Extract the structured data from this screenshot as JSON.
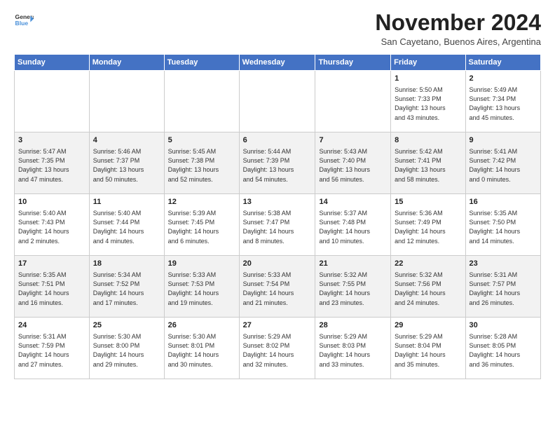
{
  "logo": {
    "line1": "General",
    "line2": "Blue"
  },
  "title": "November 2024",
  "location": "San Cayetano, Buenos Aires, Argentina",
  "days_of_week": [
    "Sunday",
    "Monday",
    "Tuesday",
    "Wednesday",
    "Thursday",
    "Friday",
    "Saturday"
  ],
  "weeks": [
    [
      {
        "day": "",
        "info": ""
      },
      {
        "day": "",
        "info": ""
      },
      {
        "day": "",
        "info": ""
      },
      {
        "day": "",
        "info": ""
      },
      {
        "day": "",
        "info": ""
      },
      {
        "day": "1",
        "info": "Sunrise: 5:50 AM\nSunset: 7:33 PM\nDaylight: 13 hours\nand 43 minutes."
      },
      {
        "day": "2",
        "info": "Sunrise: 5:49 AM\nSunset: 7:34 PM\nDaylight: 13 hours\nand 45 minutes."
      }
    ],
    [
      {
        "day": "3",
        "info": "Sunrise: 5:47 AM\nSunset: 7:35 PM\nDaylight: 13 hours\nand 47 minutes."
      },
      {
        "day": "4",
        "info": "Sunrise: 5:46 AM\nSunset: 7:37 PM\nDaylight: 13 hours\nand 50 minutes."
      },
      {
        "day": "5",
        "info": "Sunrise: 5:45 AM\nSunset: 7:38 PM\nDaylight: 13 hours\nand 52 minutes."
      },
      {
        "day": "6",
        "info": "Sunrise: 5:44 AM\nSunset: 7:39 PM\nDaylight: 13 hours\nand 54 minutes."
      },
      {
        "day": "7",
        "info": "Sunrise: 5:43 AM\nSunset: 7:40 PM\nDaylight: 13 hours\nand 56 minutes."
      },
      {
        "day": "8",
        "info": "Sunrise: 5:42 AM\nSunset: 7:41 PM\nDaylight: 13 hours\nand 58 minutes."
      },
      {
        "day": "9",
        "info": "Sunrise: 5:41 AM\nSunset: 7:42 PM\nDaylight: 14 hours\nand 0 minutes."
      }
    ],
    [
      {
        "day": "10",
        "info": "Sunrise: 5:40 AM\nSunset: 7:43 PM\nDaylight: 14 hours\nand 2 minutes."
      },
      {
        "day": "11",
        "info": "Sunrise: 5:40 AM\nSunset: 7:44 PM\nDaylight: 14 hours\nand 4 minutes."
      },
      {
        "day": "12",
        "info": "Sunrise: 5:39 AM\nSunset: 7:45 PM\nDaylight: 14 hours\nand 6 minutes."
      },
      {
        "day": "13",
        "info": "Sunrise: 5:38 AM\nSunset: 7:47 PM\nDaylight: 14 hours\nand 8 minutes."
      },
      {
        "day": "14",
        "info": "Sunrise: 5:37 AM\nSunset: 7:48 PM\nDaylight: 14 hours\nand 10 minutes."
      },
      {
        "day": "15",
        "info": "Sunrise: 5:36 AM\nSunset: 7:49 PM\nDaylight: 14 hours\nand 12 minutes."
      },
      {
        "day": "16",
        "info": "Sunrise: 5:35 AM\nSunset: 7:50 PM\nDaylight: 14 hours\nand 14 minutes."
      }
    ],
    [
      {
        "day": "17",
        "info": "Sunrise: 5:35 AM\nSunset: 7:51 PM\nDaylight: 14 hours\nand 16 minutes."
      },
      {
        "day": "18",
        "info": "Sunrise: 5:34 AM\nSunset: 7:52 PM\nDaylight: 14 hours\nand 17 minutes."
      },
      {
        "day": "19",
        "info": "Sunrise: 5:33 AM\nSunset: 7:53 PM\nDaylight: 14 hours\nand 19 minutes."
      },
      {
        "day": "20",
        "info": "Sunrise: 5:33 AM\nSunset: 7:54 PM\nDaylight: 14 hours\nand 21 minutes."
      },
      {
        "day": "21",
        "info": "Sunrise: 5:32 AM\nSunset: 7:55 PM\nDaylight: 14 hours\nand 23 minutes."
      },
      {
        "day": "22",
        "info": "Sunrise: 5:32 AM\nSunset: 7:56 PM\nDaylight: 14 hours\nand 24 minutes."
      },
      {
        "day": "23",
        "info": "Sunrise: 5:31 AM\nSunset: 7:57 PM\nDaylight: 14 hours\nand 26 minutes."
      }
    ],
    [
      {
        "day": "24",
        "info": "Sunrise: 5:31 AM\nSunset: 7:59 PM\nDaylight: 14 hours\nand 27 minutes."
      },
      {
        "day": "25",
        "info": "Sunrise: 5:30 AM\nSunset: 8:00 PM\nDaylight: 14 hours\nand 29 minutes."
      },
      {
        "day": "26",
        "info": "Sunrise: 5:30 AM\nSunset: 8:01 PM\nDaylight: 14 hours\nand 30 minutes."
      },
      {
        "day": "27",
        "info": "Sunrise: 5:29 AM\nSunset: 8:02 PM\nDaylight: 14 hours\nand 32 minutes."
      },
      {
        "day": "28",
        "info": "Sunrise: 5:29 AM\nSunset: 8:03 PM\nDaylight: 14 hours\nand 33 minutes."
      },
      {
        "day": "29",
        "info": "Sunrise: 5:29 AM\nSunset: 8:04 PM\nDaylight: 14 hours\nand 35 minutes."
      },
      {
        "day": "30",
        "info": "Sunrise: 5:28 AM\nSunset: 8:05 PM\nDaylight: 14 hours\nand 36 minutes."
      }
    ]
  ]
}
